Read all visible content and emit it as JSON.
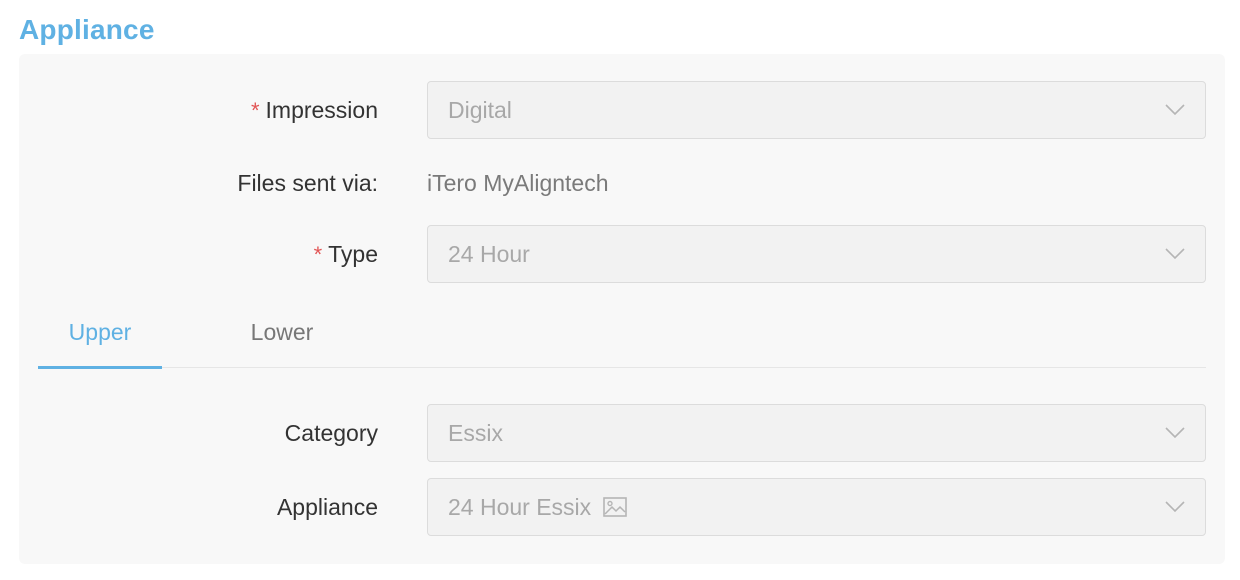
{
  "section": {
    "title": "Appliance"
  },
  "impression": {
    "label": "Impression",
    "required_mark": "*",
    "value": "Digital"
  },
  "files_sent": {
    "label": "Files sent via:",
    "value": "iTero MyAligntech"
  },
  "type": {
    "label": "Type",
    "required_mark": "*",
    "value": "24 Hour"
  },
  "tabs": [
    {
      "label": "Upper",
      "active": true
    },
    {
      "label": "Lower",
      "active": false
    }
  ],
  "category": {
    "label": "Category",
    "value": "Essix"
  },
  "appliance": {
    "label": "Appliance",
    "value": "24 Hour Essix",
    "icon": "image-icon"
  },
  "colors": {
    "accent": "#5fb1e3",
    "required": "#e25555"
  }
}
